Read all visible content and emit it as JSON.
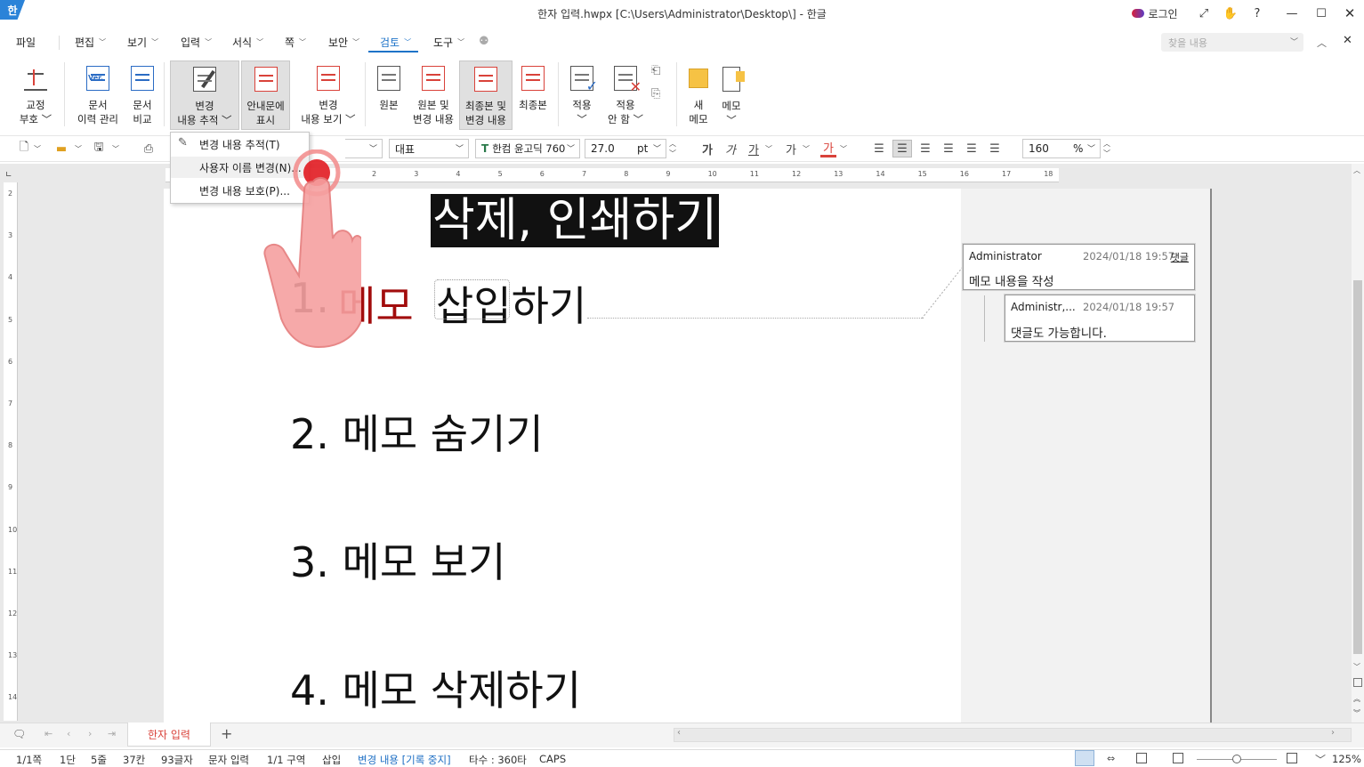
{
  "app": {
    "window_title": "한자 입력.hwpx [C:\\Users\\Administrator\\Desktop\\] - 한글",
    "logo_glyph": "한",
    "login_label": "로그인"
  },
  "menu": {
    "items": [
      "파일",
      "편집",
      "보기",
      "입력",
      "서식",
      "쪽",
      "보안",
      "검토",
      "도구"
    ],
    "active": "검토",
    "find_placeholder": "찾을 내용"
  },
  "ribbon": {
    "buttons": [
      {
        "line1": "교정",
        "line2": "부호"
      },
      {
        "line1": "문서",
        "line2": "이력 관리",
        "badge": "Ver."
      },
      {
        "line1": "문서",
        "line2": "비교"
      },
      {
        "line1": "변경",
        "line2": "내용 추적"
      },
      {
        "line1": "안내문에",
        "line2": "표시"
      },
      {
        "line1": "변경",
        "line2": "내용 보기"
      },
      {
        "line1": "원본",
        "line2": ""
      },
      {
        "line1": "원본 및",
        "line2": "변경 내용"
      },
      {
        "line1": "최종본 및",
        "line2": "변경 내용"
      },
      {
        "line1": "최종본",
        "line2": ""
      },
      {
        "line1": "적용",
        "line2": ""
      },
      {
        "line1": "적용",
        "line2": "안 함"
      },
      {
        "line1": "새",
        "line2": "메모"
      },
      {
        "line1": "메모",
        "line2": ""
      }
    ]
  },
  "toolbar": {
    "style": "대표",
    "font": "한컴 윤고딕 760",
    "size": "27.0",
    "unit": "pt",
    "zoom_value": "160",
    "zoom_unit": "%",
    "font_icon": "T",
    "format_buttons": [
      "가",
      "가",
      "가",
      "가",
      "가"
    ]
  },
  "dropdown": {
    "items": [
      "변경 내용 추적(T)",
      "사용자 이름 변경(N)...",
      "변경 내용 보호(P)..."
    ]
  },
  "ruler": {
    "h_numbers": [
      "2",
      "3",
      "4",
      "5",
      "6",
      "7",
      "8",
      "9",
      "10",
      "11",
      "12",
      "13",
      "14",
      "15",
      "16",
      "17",
      "18"
    ],
    "v_numbers": [
      "2",
      "3",
      "4",
      "5",
      "6",
      "7",
      "8",
      "9",
      "10",
      "11",
      "12",
      "13",
      "14"
    ]
  },
  "document": {
    "title": "삭제, 인쇄하기",
    "line1_num": "1.",
    "line1_red": "메모",
    "line1_rest": "삽입하기",
    "line2": "2. 메모 숨기기",
    "line3": "3. 메모 보기",
    "line4": "4. 메모 삭제하기"
  },
  "memos": [
    {
      "author": "Administrator",
      "time": "2024/01/18 19:57",
      "reply": "댓글",
      "body": "메모 내용을 작성"
    },
    {
      "author": "Administr,...",
      "time": "2024/01/18 19:57",
      "body": "댓글도 가능합니다."
    }
  ],
  "tabs": {
    "active": "한자 입력",
    "add": "+"
  },
  "status": {
    "page": "1/1쪽",
    "column": "1단",
    "line": "5줄",
    "col": "37칸",
    "chars": "93글자",
    "mode": "문자 입력",
    "section": "1/1 구역",
    "insert": "삽입",
    "track": "변경 내용 [기록 중지]",
    "typing": "타수 : 360타",
    "caps": "CAPS",
    "zoom": "125%"
  },
  "colors": {
    "accent": "#1e73c8",
    "track_red": "#d9423a",
    "highlight_bg": "#111111"
  }
}
